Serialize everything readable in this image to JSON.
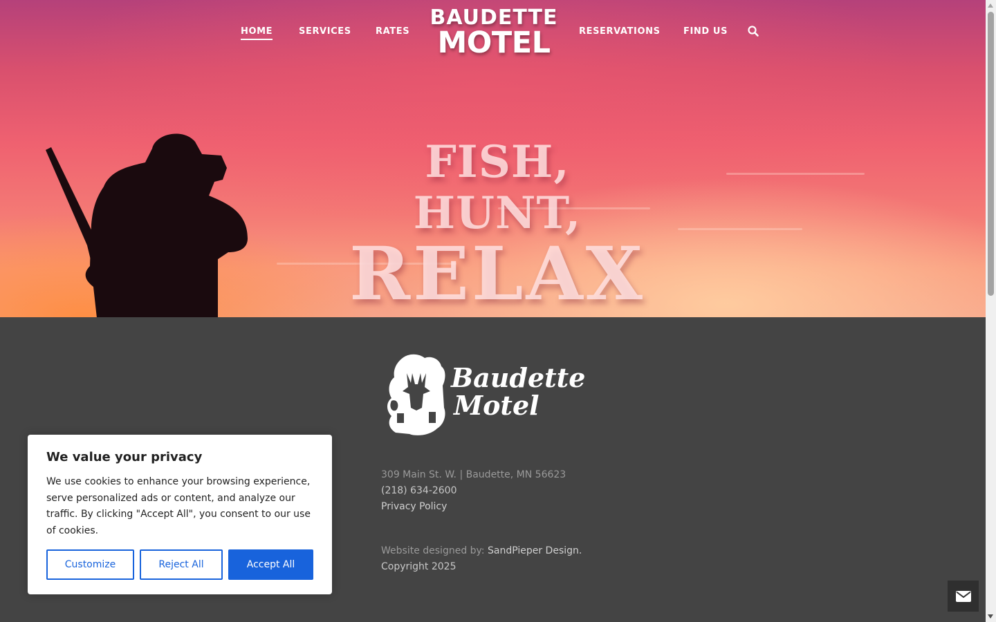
{
  "nav": {
    "items": [
      {
        "label": "HOME",
        "active": true
      },
      {
        "label": "SERVICES"
      },
      {
        "label": "RATES"
      },
      {
        "label": "RESERVATIONS"
      },
      {
        "label": "FIND US"
      }
    ],
    "search_icon": "search-icon"
  },
  "logo": {
    "line1": "BAUDETTE",
    "line2": "MOTEL"
  },
  "hero": {
    "line1": "FISH, HUNT,",
    "line2": "RELAX"
  },
  "footer": {
    "logo_line1": "Baudette",
    "logo_line2": "Motel",
    "address": "309 Main St. W. | Baudette, MN 56623",
    "phone": "(218) 634-2600",
    "privacy_link": "Privacy Policy",
    "designed_by_prefix": "Website designed by:",
    "designer_link": "SandPieper Design.",
    "copyright": "Copyright 2025"
  },
  "cookie_banner": {
    "title": "We value your privacy",
    "body": "We use cookies to enhance your browsing experience, serve personalized ads or content, and analyze our traffic. By clicking \"Accept All\", you consent to our use of cookies.",
    "customize": "Customize",
    "reject": "Reject All",
    "accept": "Accept All",
    "accent_color": "#1863dc"
  },
  "contact_button_icon": "envelope-icon"
}
